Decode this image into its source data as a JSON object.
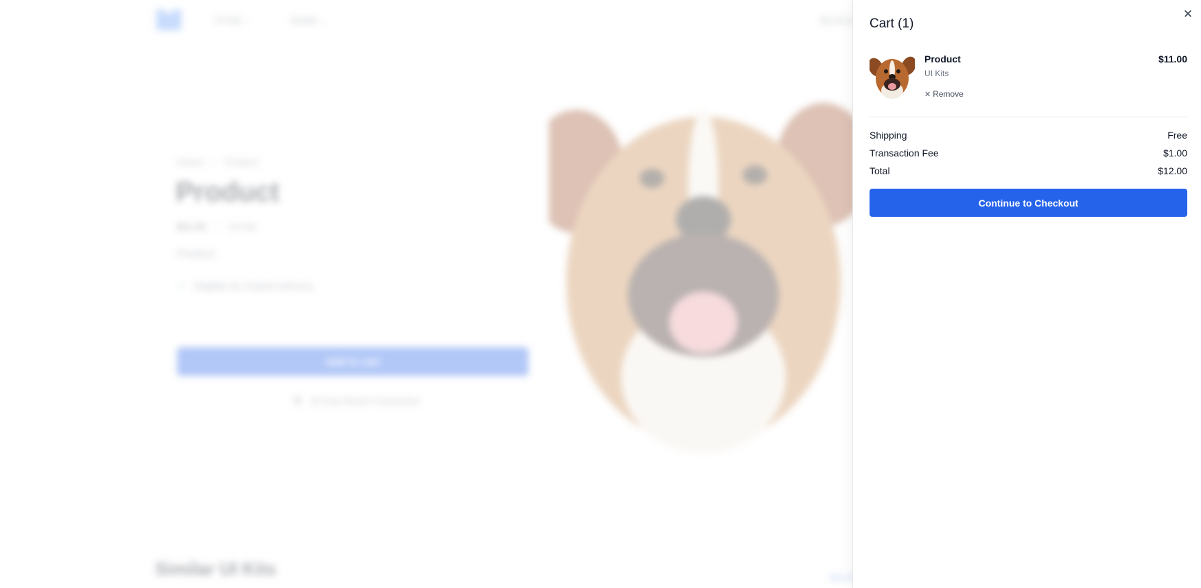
{
  "background": {
    "nav": {
      "logo_icon": "brand-logo-icon",
      "links": [
        "UI Kits",
        "Assets"
      ],
      "right_link": "My Account"
    },
    "breadcrumb": [
      "Home",
      "Product"
    ],
    "product": {
      "title": "Product",
      "price": "$11.00",
      "category": "UI Kits",
      "description": "Product",
      "feature": "Eligible for instant delivery",
      "add_to_cart_label": "Add to cart",
      "guarantee": "30 Day Return Guarantee"
    },
    "similar_heading": "Similar UI Kits",
    "see_all_label": "See all"
  },
  "cart": {
    "title": "Cart (1)",
    "close_icon": "close-icon",
    "items": [
      {
        "name": "Product",
        "category": "UI Kits",
        "price": "$11.00",
        "remove_label": "Remove",
        "remove_icon": "x-icon",
        "thumbnail": "dog-photo"
      }
    ],
    "summary": {
      "shipping_label": "Shipping",
      "shipping_value": "Free",
      "fee_label": "Transaction Fee",
      "fee_value": "$1.00",
      "total_label": "Total",
      "total_value": "$12.00"
    },
    "checkout_label": "Continue to Checkout",
    "accent_color": "#2563eb"
  }
}
